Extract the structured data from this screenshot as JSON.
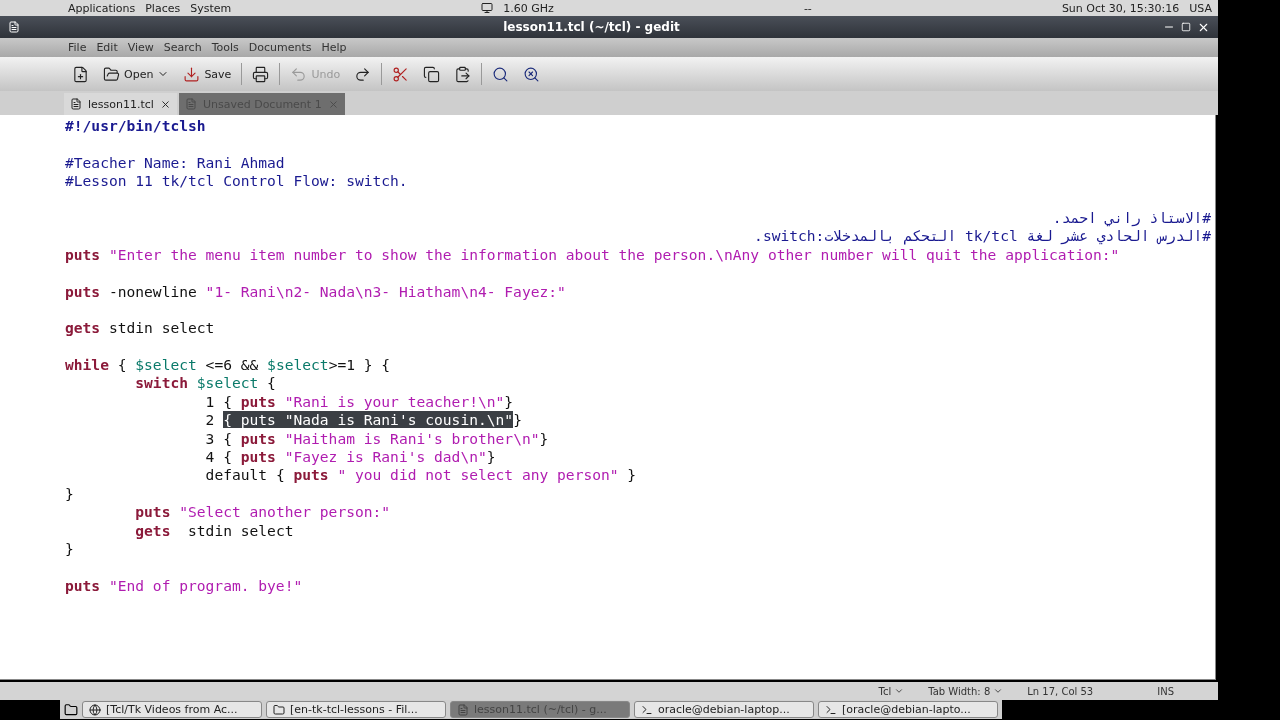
{
  "top_panel": {
    "menus": [
      "Applications",
      "Places",
      "System"
    ],
    "cpu": "1.60 GHz",
    "separator": "--",
    "clock": "Sun Oct 30, 15:30:16",
    "keyboard": "USA"
  },
  "window": {
    "title": "lesson11.tcl (~/tcl) - gedit"
  },
  "menu": [
    "File",
    "Edit",
    "View",
    "Search",
    "Tools",
    "Documents",
    "Help"
  ],
  "toolbar": [
    {
      "kind": "new"
    },
    {
      "kind": "open",
      "label": "Open",
      "disabled": false
    },
    {
      "kind": "save",
      "label": "Save",
      "disabled": false
    },
    {
      "kind": "print"
    },
    {
      "kind": "undo",
      "label": "Undo",
      "disabled": true
    },
    {
      "kind": "redo"
    },
    {
      "kind": "cut"
    },
    {
      "kind": "copy"
    },
    {
      "kind": "paste"
    },
    {
      "kind": "find"
    },
    {
      "kind": "replace"
    }
  ],
  "tabs": [
    {
      "label": "lesson11.tcl",
      "selected": true
    },
    {
      "label": "Unsaved Document 1",
      "selected": false
    }
  ],
  "editor": {
    "lines": [
      {
        "kind": "code",
        "segments": [
          {
            "kind": "shebang",
            "text": "#!/usr/bin/tclsh"
          }
        ]
      },
      {
        "kind": "blank"
      },
      {
        "kind": "code",
        "segments": [
          {
            "kind": "comment",
            "text": "#Teacher Name: Rani Ahmad"
          }
        ]
      },
      {
        "kind": "code",
        "segments": [
          {
            "kind": "comment",
            "text": "#Lesson 11 tk/tcl Control Flow: switch."
          }
        ]
      },
      {
        "kind": "blank"
      },
      {
        "kind": "rtl",
        "segments": [
          {
            "kind": "comment",
            "text": "#الاستاذ راني احمد."
          }
        ]
      },
      {
        "kind": "rtl",
        "segments": [
          {
            "kind": "comment",
            "text": "#الدرس الحادي عشر لغة tk/tcl التحكم بالمدخلات:switch."
          }
        ]
      },
      {
        "kind": "code",
        "segments": [
          {
            "kind": "keyword",
            "text": "puts "
          },
          {
            "kind": "string",
            "text": "\"Enter the menu item number to show the information about the person.\\nAny other number will quit the application:\""
          }
        ]
      },
      {
        "kind": "blank"
      },
      {
        "kind": "code",
        "segments": [
          {
            "kind": "keyword",
            "text": "puts"
          },
          {
            "kind": "plain",
            "text": " -nonewline "
          },
          {
            "kind": "string",
            "text": "\"1- Rani\\n2- Nada\\n3- Hiatham\\n4- Fayez:\""
          }
        ]
      },
      {
        "kind": "blank"
      },
      {
        "kind": "code",
        "segments": [
          {
            "kind": "keyword",
            "text": "gets"
          },
          {
            "kind": "plain",
            "text": " stdin select"
          }
        ]
      },
      {
        "kind": "blank"
      },
      {
        "kind": "code",
        "segments": [
          {
            "kind": "keyword",
            "text": "while"
          },
          {
            "kind": "plain",
            "text": " { "
          },
          {
            "kind": "variable",
            "text": "$select"
          },
          {
            "kind": "plain",
            "text": " <=6 && "
          },
          {
            "kind": "variable",
            "text": "$select"
          },
          {
            "kind": "plain",
            "text": ">=1 } {"
          }
        ]
      },
      {
        "kind": "code",
        "segments": [
          {
            "kind": "keyword",
            "text": "\tswitch "
          },
          {
            "kind": "variable",
            "text": "$select"
          },
          {
            "kind": "plain",
            "text": " {"
          }
        ]
      },
      {
        "kind": "code",
        "segments": [
          {
            "kind": "plain",
            "text": "\t\t1 { "
          },
          {
            "kind": "keyword",
            "text": "puts "
          },
          {
            "kind": "string",
            "text": "\"Rani is your teacher!\\n\""
          },
          {
            "kind": "plain",
            "text": "}"
          }
        ]
      },
      {
        "kind": "code",
        "segments": [
          {
            "kind": "plain",
            "text": "\t\t2 "
          },
          {
            "kind": "selected",
            "text": "{ puts \"Nada is Rani's cousin.\\n\""
          },
          {
            "kind": "plain",
            "text": "}"
          }
        ]
      },
      {
        "kind": "code",
        "segments": [
          {
            "kind": "plain",
            "text": "\t\t3 { "
          },
          {
            "kind": "keyword",
            "text": "puts "
          },
          {
            "kind": "string",
            "text": "\"Haitham is Rani's brother\\n\""
          },
          {
            "kind": "plain",
            "text": "}"
          }
        ]
      },
      {
        "kind": "code",
        "segments": [
          {
            "kind": "plain",
            "text": "\t\t4 { "
          },
          {
            "kind": "keyword",
            "text": "puts "
          },
          {
            "kind": "string",
            "text": "\"Fayez is Rani's dad\\n\""
          },
          {
            "kind": "plain",
            "text": "}"
          }
        ]
      },
      {
        "kind": "code",
        "segments": [
          {
            "kind": "plain",
            "text": "\t\tdefault { "
          },
          {
            "kind": "keyword",
            "text": "puts "
          },
          {
            "kind": "string",
            "text": "\" you did not select any person\""
          },
          {
            "kind": "plain",
            "text": " }"
          }
        ]
      },
      {
        "kind": "code",
        "segments": [
          {
            "kind": "plain",
            "text": "}"
          }
        ]
      },
      {
        "kind": "code",
        "segments": [
          {
            "kind": "keyword",
            "text": "\tputs "
          },
          {
            "kind": "string",
            "text": "\"Select another person:\""
          }
        ]
      },
      {
        "kind": "code",
        "segments": [
          {
            "kind": "keyword",
            "text": "\tgets"
          },
          {
            "kind": "plain",
            "text": "  stdin select"
          }
        ]
      },
      {
        "kind": "code",
        "segments": [
          {
            "kind": "plain",
            "text": "}"
          }
        ]
      },
      {
        "kind": "blank"
      },
      {
        "kind": "code",
        "segments": [
          {
            "kind": "keyword",
            "text": "puts "
          },
          {
            "kind": "string",
            "text": "\"End of program. bye!\""
          }
        ]
      }
    ]
  },
  "status_bar": {
    "language": "Tcl",
    "tab_width": "Tab Width: 8",
    "position": "Ln 17, Col 53",
    "mode": "INS"
  },
  "taskbar": [
    {
      "label": "[Tcl/Tk Videos from Ac...",
      "selected": false
    },
    {
      "label": "[en-tk-tcl-lessons - Fil...",
      "selected": false
    },
    {
      "label": "lesson11.tcl (~/tcl) - g...",
      "selected": true
    },
    {
      "label": "oracle@debian-laptop...",
      "selected": false
    },
    {
      "label": "[oracle@debian-lapto...",
      "selected": false
    }
  ]
}
